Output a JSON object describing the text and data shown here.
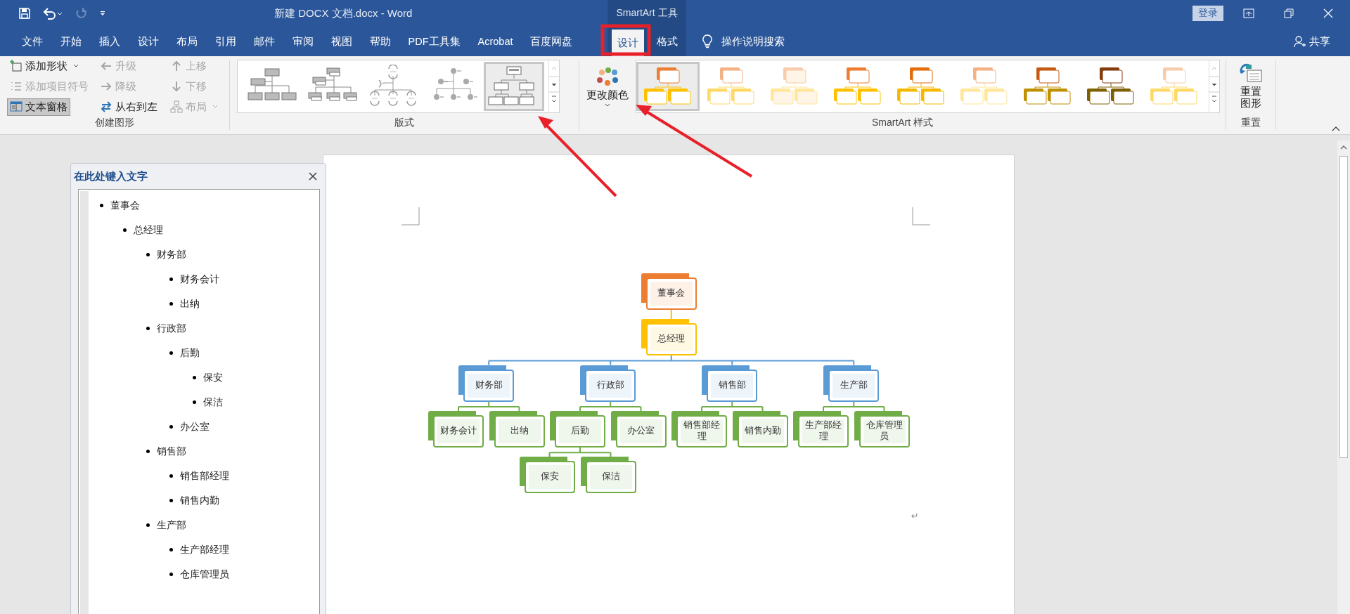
{
  "window": {
    "title": "新建 DOCX 文档.docx  -  Word",
    "tool_group": "SmartArt 工具",
    "sign_in": "登录"
  },
  "quick_access": [
    {
      "kind": "save",
      "disabled": false
    },
    {
      "kind": "undo",
      "disabled": false
    },
    {
      "kind": "redo",
      "disabled": true
    },
    {
      "kind": "customize",
      "disabled": false
    }
  ],
  "tabs": [
    {
      "label": "文件",
      "selected": false,
      "contextual": false
    },
    {
      "label": "开始",
      "selected": false,
      "contextual": false
    },
    {
      "label": "插入",
      "selected": false,
      "contextual": false
    },
    {
      "label": "设计",
      "selected": false,
      "contextual": false
    },
    {
      "label": "布局",
      "selected": false,
      "contextual": false
    },
    {
      "label": "引用",
      "selected": false,
      "contextual": false
    },
    {
      "label": "邮件",
      "selected": false,
      "contextual": false
    },
    {
      "label": "审阅",
      "selected": false,
      "contextual": false
    },
    {
      "label": "视图",
      "selected": false,
      "contextual": false
    },
    {
      "label": "帮助",
      "selected": false,
      "contextual": false
    },
    {
      "label": "PDF工具集",
      "selected": false,
      "contextual": false
    },
    {
      "label": "Acrobat",
      "selected": false,
      "contextual": false
    },
    {
      "label": "百度网盘",
      "selected": false,
      "contextual": false
    },
    {
      "label": "设计",
      "selected": true,
      "contextual": true
    },
    {
      "label": "格式",
      "selected": false,
      "contextual": true
    }
  ],
  "tell_me": "操作说明搜索",
  "share": "共享",
  "create_graphic": {
    "label": "创建图形",
    "commands": [
      {
        "kind": "add-shape",
        "label": "添加形状",
        "dropdown": true,
        "disabled": false,
        "selected": false
      },
      {
        "kind": "promote",
        "label": "升级",
        "dropdown": false,
        "disabled": true,
        "selected": false
      },
      {
        "kind": "move-up",
        "label": "上移",
        "dropdown": false,
        "disabled": true,
        "selected": false
      },
      {
        "kind": "add-bullet",
        "label": "添加项目符号",
        "dropdown": false,
        "disabled": true,
        "selected": false
      },
      {
        "kind": "demote",
        "label": "降级",
        "dropdown": false,
        "disabled": true,
        "selected": false
      },
      {
        "kind": "move-down",
        "label": "下移",
        "dropdown": false,
        "disabled": true,
        "selected": false
      },
      {
        "kind": "text-pane",
        "label": "文本窗格",
        "dropdown": false,
        "disabled": false,
        "selected": true
      },
      {
        "kind": "right-to-left",
        "label": "从右到左",
        "dropdown": false,
        "disabled": false,
        "selected": false
      },
      {
        "kind": "layout",
        "label": "布局",
        "dropdown": true,
        "disabled": true,
        "selected": false
      }
    ]
  },
  "layouts": {
    "label": "版式",
    "items": [
      {
        "kind": "org-chart",
        "selected": false
      },
      {
        "kind": "name-title",
        "selected": false
      },
      {
        "kind": "half-circle",
        "selected": false
      },
      {
        "kind": "labeled",
        "selected": false
      },
      {
        "kind": "hierarchy",
        "selected": true
      }
    ]
  },
  "styles": {
    "label": "SmartArt 样式",
    "change_colors": "更改颜色",
    "items": [
      {
        "selected": true
      },
      {
        "selected": false
      },
      {
        "selected": false
      },
      {
        "selected": false
      },
      {
        "selected": false
      },
      {
        "selected": false
      },
      {
        "selected": false
      },
      {
        "selected": false
      },
      {
        "selected": false
      }
    ]
  },
  "reset": {
    "label": "重置",
    "button": "重置图形"
  },
  "text_pane": {
    "title": "在此处键入文字",
    "items": [
      {
        "text": "董事会",
        "children": [
          {
            "text": "总经理",
            "children": [
              {
                "text": "财务部",
                "children": [
                  {
                    "text": "财务会计"
                  },
                  {
                    "text": "出纳"
                  }
                ]
              },
              {
                "text": "行政部",
                "children": [
                  {
                    "text": "后勤",
                    "children": [
                      {
                        "text": "保安"
                      },
                      {
                        "text": "保洁"
                      }
                    ]
                  },
                  {
                    "text": "办公室"
                  }
                ]
              },
              {
                "text": "销售部",
                "children": [
                  {
                    "text": "销售部经理"
                  },
                  {
                    "text": "销售内勤"
                  }
                ]
              },
              {
                "text": "生产部",
                "children": [
                  {
                    "text": "生产部经理"
                  },
                  {
                    "text": "仓库管理员"
                  }
                ]
              }
            ]
          }
        ]
      }
    ]
  },
  "document": {
    "paragraph_mark": "↵",
    "diagram": {
      "text": "董事会",
      "color": "#ed7d31",
      "children": [
        {
          "text": "总经理",
          "color": "#ffc000",
          "children": [
            {
              "text": "财务部",
              "color": "#5b9bd5",
              "children": [
                {
                  "text": "财务会计",
                  "color": "#70ad47"
                },
                {
                  "text": "出纳",
                  "color": "#70ad47"
                }
              ]
            },
            {
              "text": "行政部",
              "color": "#5b9bd5",
              "children": [
                {
                  "text": "后勤",
                  "color": "#70ad47",
                  "children": [
                    {
                      "text": "保安",
                      "color": "#70ad47"
                    },
                    {
                      "text": "保洁",
                      "color": "#70ad47"
                    }
                  ]
                },
                {
                  "text": "办公室",
                  "color": "#70ad47"
                }
              ]
            },
            {
              "text": "销售部",
              "color": "#5b9bd5",
              "children": [
                {
                  "text": "销售部经理",
                  "color": "#70ad47"
                },
                {
                  "text": "销售内勤",
                  "color": "#70ad47"
                }
              ]
            },
            {
              "text": "生产部",
              "color": "#5b9bd5",
              "children": [
                {
                  "text": "生产部经理",
                  "color": "#70ad47"
                },
                {
                  "text": "仓库管理员",
                  "color": "#70ad47"
                }
              ]
            }
          ]
        }
      ]
    }
  }
}
